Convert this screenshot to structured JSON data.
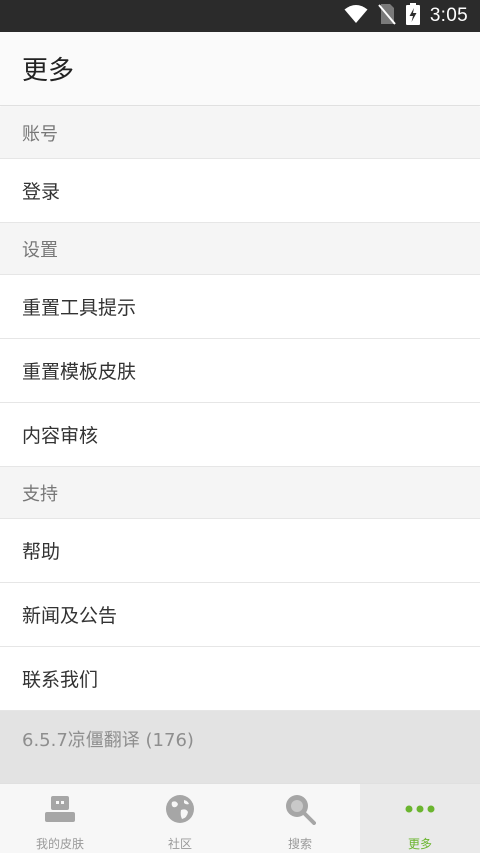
{
  "status_bar": {
    "time": "3:05",
    "icons": [
      "wifi-icon",
      "no-sim-icon",
      "battery-charging-icon"
    ]
  },
  "header": {
    "title": "更多"
  },
  "sections": [
    {
      "title": "账号",
      "items": [
        "登录"
      ]
    },
    {
      "title": "设置",
      "items": [
        "重置工具提示",
        "重置模板皮肤",
        "内容审核"
      ]
    },
    {
      "title": "支持",
      "items": [
        "帮助",
        "新闻及公告",
        "联系我们"
      ]
    }
  ],
  "version_text": "6.5.7凉僵翻译 (176)",
  "bottom_nav": {
    "tabs": [
      {
        "label": "我的皮肤",
        "icon": "skin-icon",
        "active": false
      },
      {
        "label": "社区",
        "icon": "globe-icon",
        "active": false
      },
      {
        "label": "搜索",
        "icon": "search-icon",
        "active": false
      },
      {
        "label": "更多",
        "icon": "more-dots-icon",
        "active": true
      }
    ]
  },
  "colors": {
    "accent": "#6bb52f",
    "status_bar": "#2b2b2b",
    "section_bg": "#f5f5f5",
    "version_bg": "#e3e3e3"
  }
}
